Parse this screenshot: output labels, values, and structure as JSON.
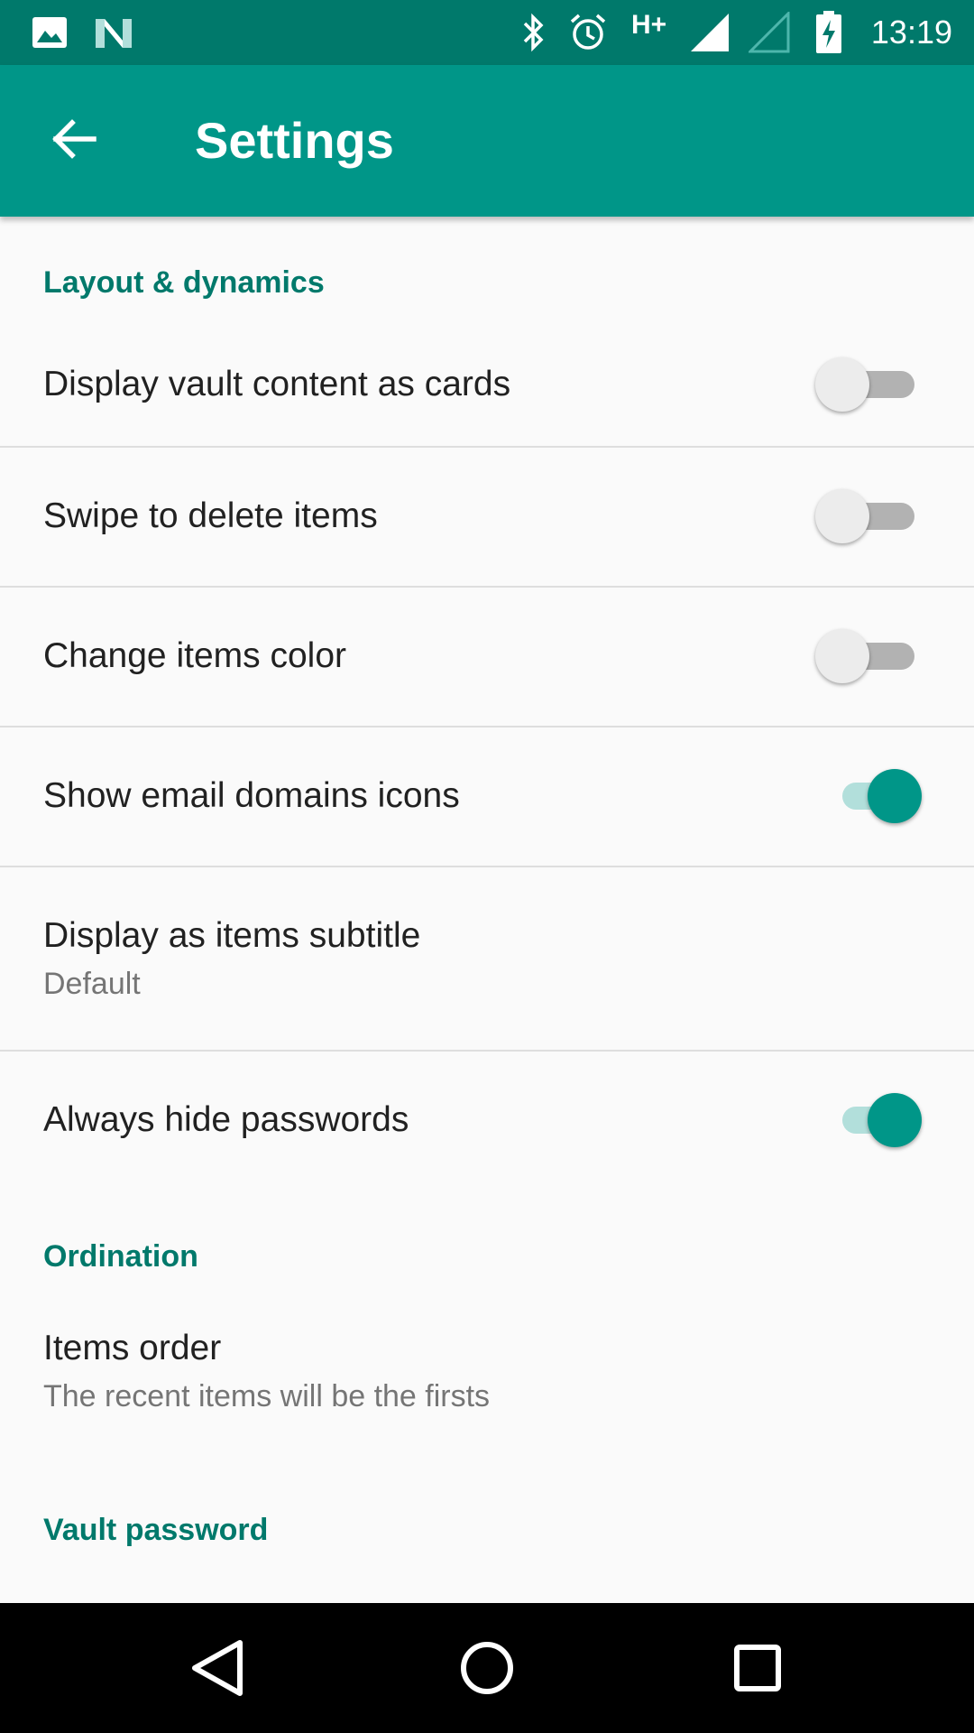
{
  "status_bar": {
    "time": "13:19",
    "network": "H+",
    "icons": [
      "image-icon",
      "n-logo-icon",
      "bluetooth-icon",
      "alarm-icon",
      "signal-icon",
      "signal-empty-icon",
      "battery-charging-icon"
    ]
  },
  "app_bar": {
    "title": "Settings",
    "back_icon": "arrow-back-icon",
    "color": "#009688"
  },
  "sections": {
    "layout": {
      "header": "Layout & dynamics",
      "display_cards": {
        "title": "Display vault content as cards",
        "enabled": false
      },
      "swipe_delete": {
        "title": "Swipe to delete items",
        "enabled": false
      },
      "change_color": {
        "title": "Change items color",
        "enabled": false
      },
      "email_icons": {
        "title": "Show email domains icons",
        "enabled": true
      },
      "items_subtitle": {
        "title": "Display as items subtitle",
        "summary": "Default"
      },
      "hide_passwords": {
        "title": "Always hide passwords",
        "enabled": true
      }
    },
    "ordination": {
      "header": "Ordination",
      "items_order": {
        "title": "Items order",
        "summary": "The recent items will be the firsts"
      }
    },
    "vault_password": {
      "header": "Vault password"
    }
  },
  "nav_bar": {
    "icons": [
      "back-triangle-icon",
      "home-circle-icon",
      "recents-square-icon"
    ]
  },
  "colors": {
    "accent": "#009688",
    "status_bar": "#00796b",
    "section_header": "#00796b"
  }
}
